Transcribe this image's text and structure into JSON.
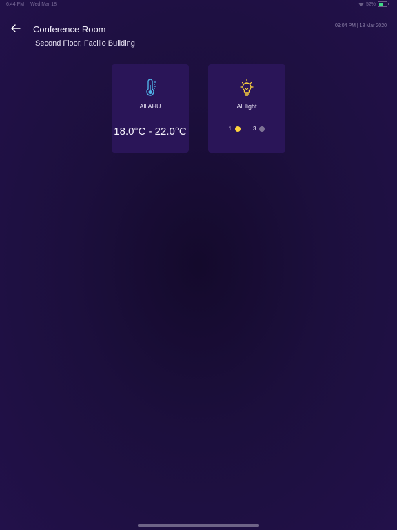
{
  "status_bar": {
    "time": "6:44 PM",
    "date": "Wed Mar 18",
    "battery": "52%",
    "battery_level": 0.52
  },
  "header": {
    "title": "Conference Room",
    "subtitle": "Second Floor, Facilio Building",
    "datetime": "09:04 PM | 18 Mar 2020",
    "back_icon": "arrow-left-icon"
  },
  "cards": {
    "ahu": {
      "icon": "thermometer-icon",
      "label": "All AHU",
      "temp_range": "18.0°C - 22.0°C",
      "icon_color": "#4fb3e8"
    },
    "light": {
      "icon": "lightbulb-icon",
      "label": "All light",
      "on_count": "1",
      "off_count": "3",
      "on_color": "#ffd33d",
      "off_color": "#7d7394"
    }
  },
  "colors": {
    "background": "#1c0f3d",
    "card": "#2a1558",
    "accent_yellow": "#ffd33d",
    "accent_blue": "#4fb3e8"
  }
}
